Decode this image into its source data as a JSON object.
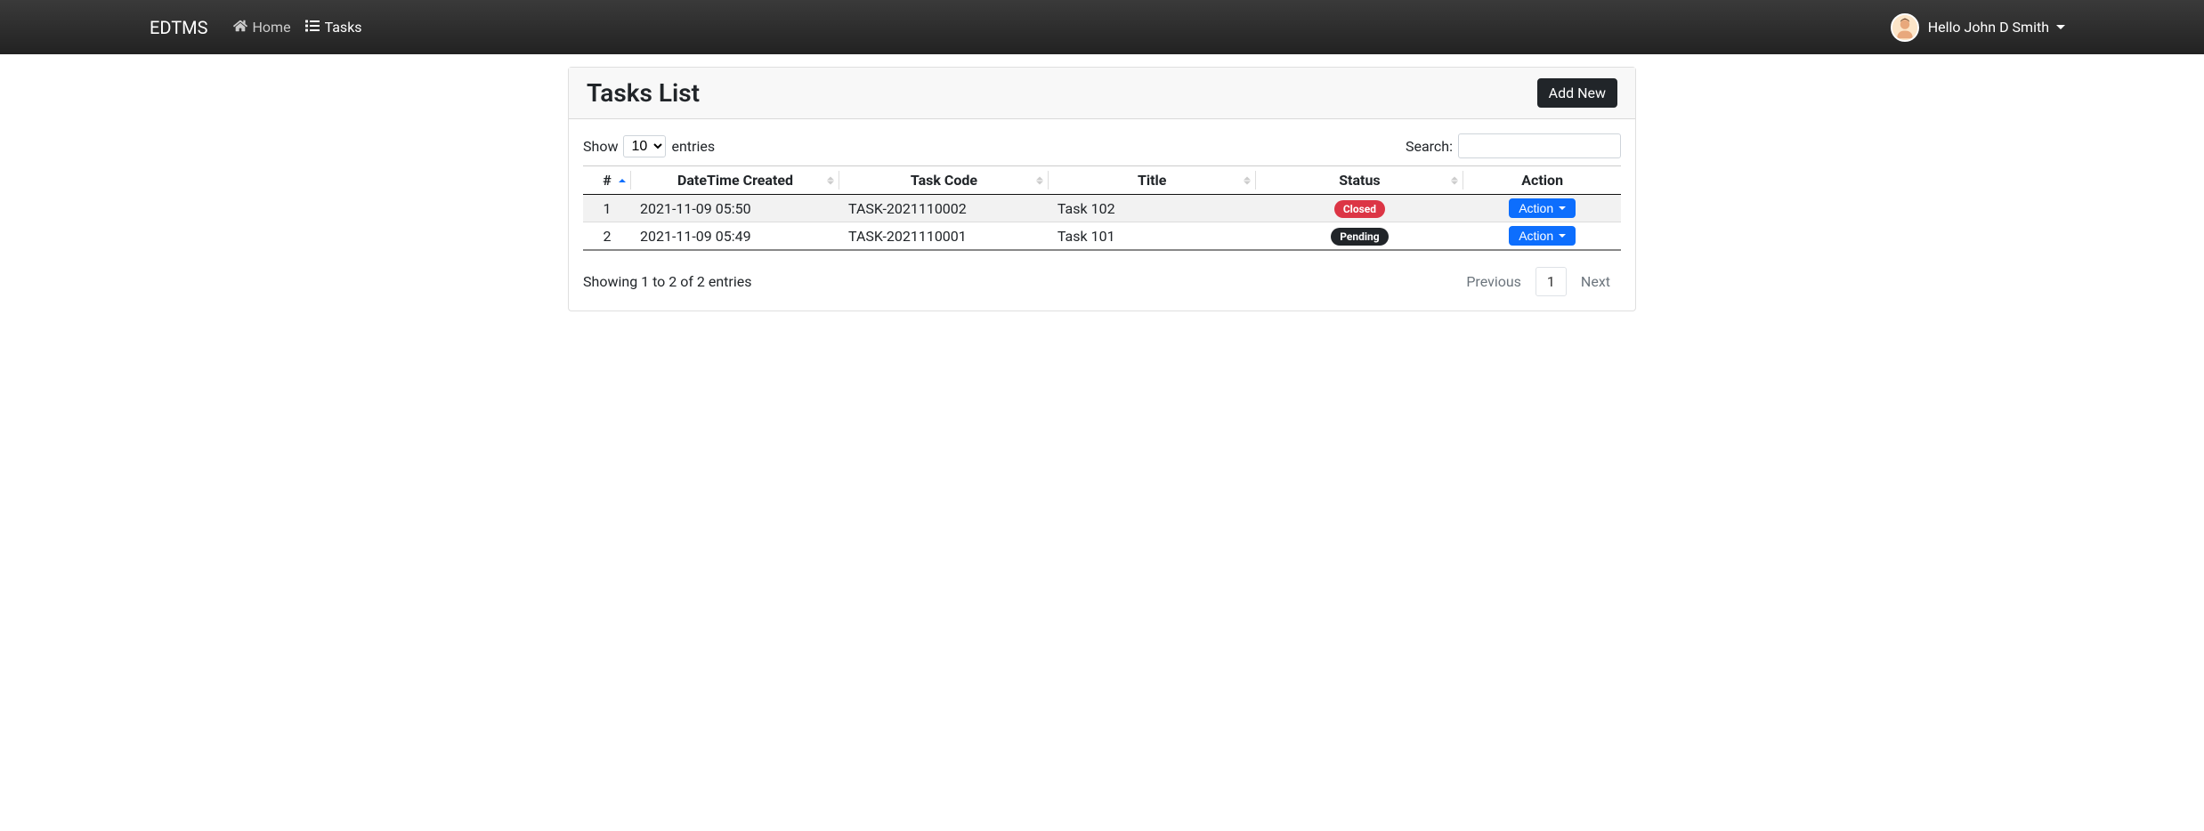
{
  "navbar": {
    "brand": "EDTMS",
    "home_label": "Home",
    "tasks_label": "Tasks",
    "greeting": "Hello John D Smith"
  },
  "page": {
    "title": "Tasks List",
    "add_new_label": "Add New"
  },
  "datatable": {
    "length_prefix": "Show",
    "length_suffix": "entries",
    "length_value": "10",
    "search_label": "Search:",
    "columns": {
      "idx": "#",
      "datetime": "DateTime Created",
      "code": "Task Code",
      "title": "Title",
      "status": "Status",
      "action": "Action"
    },
    "rows": [
      {
        "idx": "1",
        "datetime": "2021-11-09 05:50",
        "code": "TASK-2021110002",
        "title": "Task 102",
        "status_label": "Closed",
        "status_class": "danger",
        "action_label": "Action"
      },
      {
        "idx": "2",
        "datetime": "2021-11-09 05:49",
        "code": "TASK-2021110001",
        "title": "Task 101",
        "status_label": "Pending",
        "status_class": "dark",
        "action_label": "Action"
      }
    ],
    "info": "Showing 1 to 2 of 2 entries",
    "pagination": {
      "previous": "Previous",
      "next": "Next",
      "pages": [
        "1"
      ],
      "active": "1"
    }
  }
}
